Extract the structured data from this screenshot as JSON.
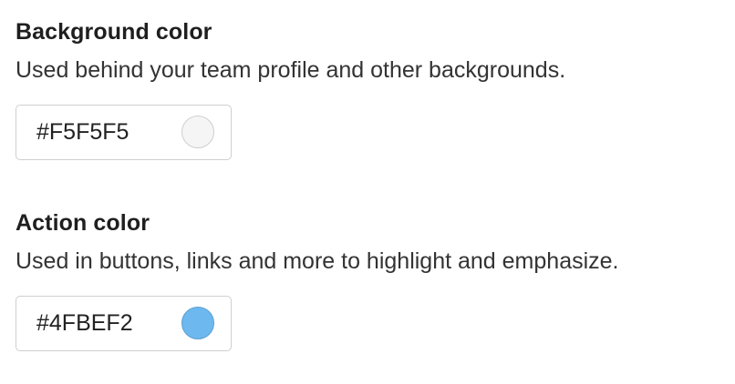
{
  "background_color": {
    "title": "Background color",
    "description": "Used behind your team profile and other backgrounds.",
    "value": "#F5F5F5",
    "swatch_color": "#F5F5F5"
  },
  "action_color": {
    "title": "Action color",
    "description": "Used in buttons, links and more to highlight and emphasize.",
    "value": "#4FBEF2",
    "swatch_color": "#6DB8EE"
  }
}
